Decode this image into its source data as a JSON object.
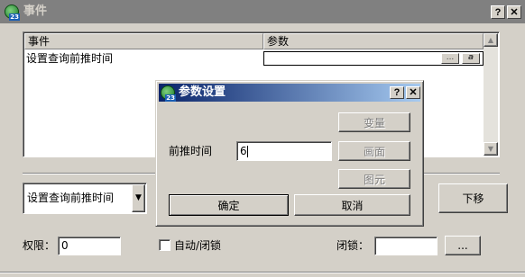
{
  "main_window": {
    "title": "事件",
    "help_button": "?",
    "close_button": "✕"
  },
  "event_table": {
    "columns": [
      "事件",
      "参数"
    ],
    "rows": [
      {
        "event": "设置查询前推时间",
        "param": ""
      }
    ],
    "param_dots_label": "...",
    "param_a_label": "a"
  },
  "event_select": {
    "value": "设置查询前推时间"
  },
  "move_down_button": "下移",
  "permission": {
    "label": "权限：",
    "value": "0"
  },
  "auto_close_lock": {
    "label": "自动/闭锁",
    "checked": false
  },
  "lock": {
    "label": "闭锁：",
    "value": "",
    "browse_label": "..."
  },
  "dialog": {
    "title": "参数设置",
    "help_button": "?",
    "close_button": "✕",
    "field_label": "前推时间",
    "field_value": "6",
    "buttons": {
      "variable": "变量",
      "screen": "画面",
      "element": "图元",
      "ok": "确定",
      "cancel": "取消"
    }
  },
  "colors": {
    "face": "#d4d0c8",
    "inactive_title": "#808080",
    "active_title_start": "#0a246a",
    "active_title_end": "#a6caf0"
  }
}
